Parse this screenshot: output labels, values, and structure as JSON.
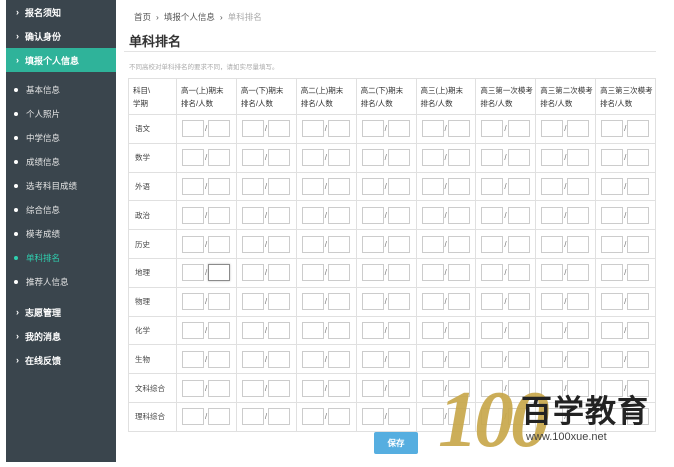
{
  "sidebar": {
    "top_sections": [
      {
        "label": "报名须知",
        "active": false
      },
      {
        "label": "确认身份",
        "active": false
      },
      {
        "label": "填报个人信息",
        "active": true
      }
    ],
    "sub_items": [
      {
        "label": "基本信息",
        "active": false
      },
      {
        "label": "个人照片",
        "active": false
      },
      {
        "label": "中学信息",
        "active": false
      },
      {
        "label": "成绩信息",
        "active": false
      },
      {
        "label": "选考科目成绩",
        "active": false
      },
      {
        "label": "综合信息",
        "active": false
      },
      {
        "label": "模考成绩",
        "active": false
      },
      {
        "label": "单科排名",
        "active": true
      },
      {
        "label": "推荐人信息",
        "active": false
      }
    ],
    "bottom_sections": [
      {
        "label": "志愿管理"
      },
      {
        "label": "我的消息"
      },
      {
        "label": "在线反馈"
      }
    ]
  },
  "breadcrumb": {
    "home": "首页",
    "parent": "填报个人信息",
    "current": "单科排名",
    "separator": "›"
  },
  "page": {
    "title": "单科排名",
    "notice": "不同高校对单科排名的要求不同，请如实尽量填写。"
  },
  "table": {
    "corner_line1": "科目\\",
    "corner_line2": "学期",
    "columns": [
      {
        "line1": "高一(上)期末",
        "line2": "排名/人数"
      },
      {
        "line1": "高一(下)期末",
        "line2": "排名/人数"
      },
      {
        "line1": "高二(上)期末",
        "line2": "排名/人数"
      },
      {
        "line1": "高二(下)期末",
        "line2": "排名/人数"
      },
      {
        "line1": "高三(上)期末",
        "line2": "排名/人数"
      },
      {
        "line1": "高三第一次模考",
        "line2": "排名/人数"
      },
      {
        "line1": "高三第二次模考",
        "line2": "排名/人数"
      },
      {
        "line1": "高三第三次模考",
        "line2": "排名/人数"
      }
    ],
    "subjects": [
      "语文",
      "数学",
      "外语",
      "政治",
      "历史",
      "地理",
      "物理",
      "化学",
      "生物",
      "文科综合",
      "理科综合"
    ],
    "separator": "/"
  },
  "save_label": "保存",
  "watermark": {
    "number": "100",
    "brand": "百学教育",
    "url": "www.100xue.net"
  },
  "colors": {
    "sidebar_bg": "#3a454d",
    "sidebar_active": "#2fb39a",
    "button": "#56aee0",
    "logo_gold": "#c8a84b"
  }
}
